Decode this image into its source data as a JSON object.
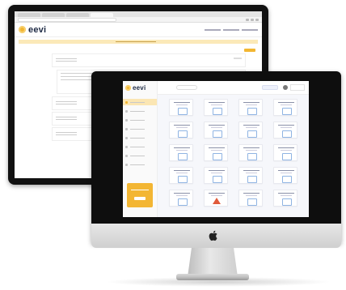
{
  "back_app": {
    "logo_text": "eevi"
  },
  "front_app": {
    "logo_text": "eevi"
  },
  "colors": {
    "brand_yellow": "#f2b632",
    "navy": "#1e2a44",
    "warning_red": "#e05a3a"
  },
  "icons": {
    "device_logo": "apple-icon"
  }
}
